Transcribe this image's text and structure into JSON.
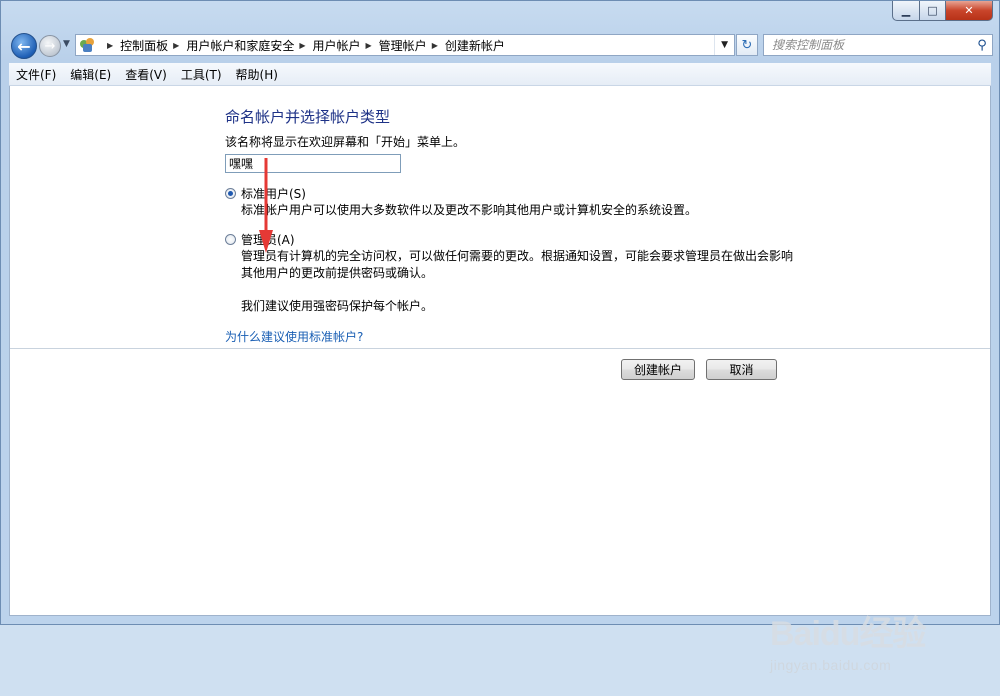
{
  "window": {
    "controls": {
      "minimize_icon": "minimize-icon",
      "maximize_icon": "maximize-icon",
      "close_icon": "close-icon"
    }
  },
  "nav": {
    "breadcrumbs": [
      "控制面板",
      "用户帐户和家庭安全",
      "用户帐户",
      "管理帐户",
      "创建新帐户"
    ],
    "search_placeholder": "搜索控制面板"
  },
  "menu": [
    "文件(F)",
    "编辑(E)",
    "查看(V)",
    "工具(T)",
    "帮助(H)"
  ],
  "form": {
    "heading": "命名帐户并选择帐户类型",
    "description": "该名称将显示在欢迎屏幕和「开始」菜单上。",
    "name_value": "嘿嘿",
    "options": [
      {
        "label": "标准用户(S)",
        "checked": true,
        "desc": [
          "标准帐户用户可以使用大多数软件以及更改不影响其他用户或计算机安全的系统设置。"
        ]
      },
      {
        "label": "管理员(A)",
        "checked": false,
        "desc": [
          "管理员有计算机的完全访问权，可以做任何需要的更改。根据通知设置，可能会要求管理员在做出会影响",
          "其他用户的更改前提供密码或确认。"
        ]
      }
    ],
    "recommend": "我们建议使用强密码保护每个帐户。",
    "why_link": "为什么建议使用标准帐户?"
  },
  "buttons": {
    "create": "创建帐户",
    "cancel": "取消"
  },
  "watermark": {
    "logo": "Baidu经验",
    "url": "jingyan.baidu.com"
  },
  "colors": {
    "heading": "#1e3287",
    "link": "#1a5fb4",
    "arrow": "#e53935"
  }
}
